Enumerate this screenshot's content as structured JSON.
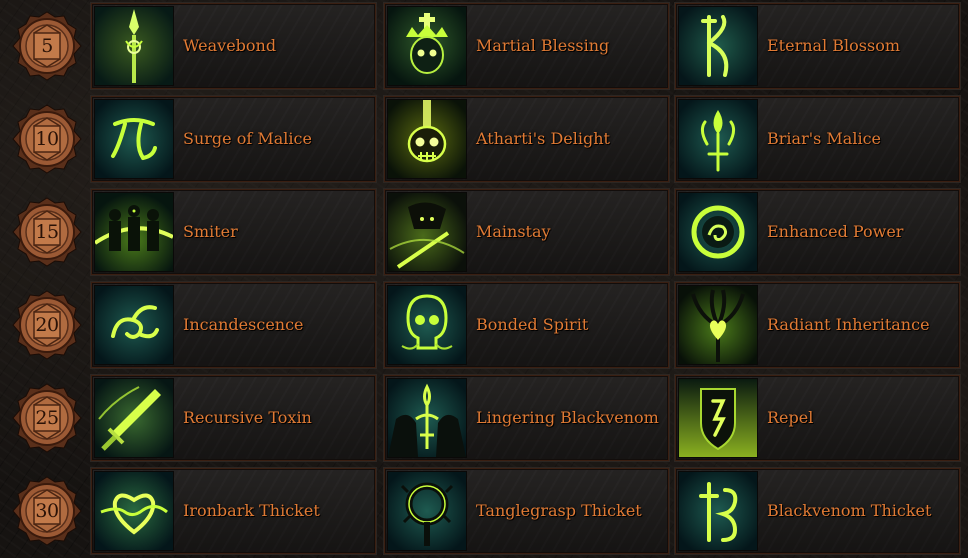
{
  "colors": {
    "label": "#e07a34",
    "glow": "#c8ff3a",
    "badge": "#9c5a35"
  },
  "tiers": [
    {
      "level": "5",
      "skills": [
        {
          "name": "Weavebond",
          "icon": "spear-icon"
        },
        {
          "name": "Martial Blessing",
          "icon": "crowned-skull-icon"
        },
        {
          "name": "Eternal Blossom",
          "icon": "rune-icon"
        }
      ]
    },
    {
      "level": "10",
      "skills": [
        {
          "name": "Surge of Malice",
          "icon": "malice-rune-icon"
        },
        {
          "name": "Atharti's Delight",
          "icon": "skull-icon"
        },
        {
          "name": "Briar's Malice",
          "icon": "briar-icon"
        }
      ]
    },
    {
      "level": "15",
      "skills": [
        {
          "name": "Smiter",
          "icon": "figures-icon"
        },
        {
          "name": "Mainstay",
          "icon": "hooded-figure-icon"
        },
        {
          "name": "Enhanced Power",
          "icon": "power-orb-icon"
        }
      ]
    },
    {
      "level": "20",
      "skills": [
        {
          "name": "Incandescence",
          "icon": "swirl-icon"
        },
        {
          "name": "Bonded Spirit",
          "icon": "spirit-skull-icon"
        },
        {
          "name": "Radiant Inheritance",
          "icon": "tree-heart-icon"
        }
      ]
    },
    {
      "level": "25",
      "skills": [
        {
          "name": "Recursive Toxin",
          "icon": "dagger-icon"
        },
        {
          "name": "Lingering Blackvenom",
          "icon": "venom-figure-icon"
        },
        {
          "name": "Repel",
          "icon": "shield-rune-icon"
        }
      ]
    },
    {
      "level": "30",
      "skills": [
        {
          "name": "Ironbark Thicket",
          "icon": "thorn-heart-icon"
        },
        {
          "name": "Tanglegrasp Thicket",
          "icon": "thorn-ring-icon"
        },
        {
          "name": "Blackvenom Thicket",
          "icon": "venom-rune-icon"
        }
      ]
    }
  ]
}
